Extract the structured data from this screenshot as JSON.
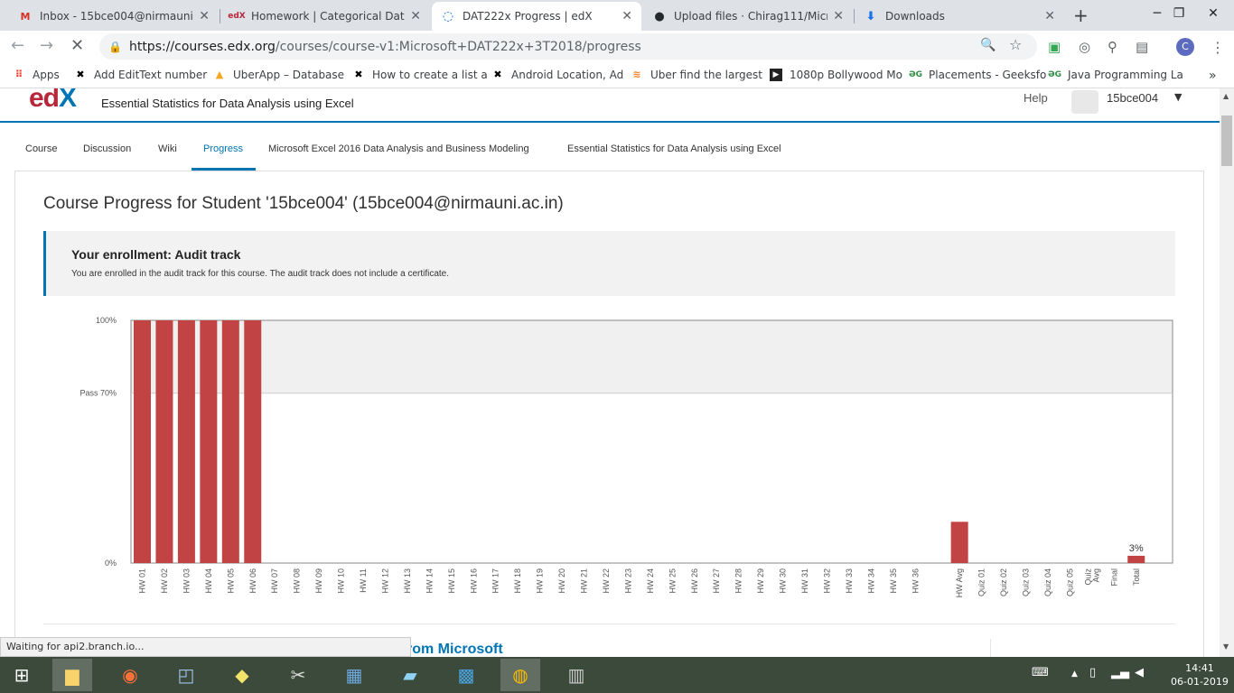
{
  "browser": {
    "tabs": [
      {
        "label": "Inbox - 15bce004@nirmauni.ac",
        "icon": "gmail-icon",
        "active": false
      },
      {
        "label": "Homework | Categorical Data, P",
        "icon": "edx-icon",
        "active": false
      },
      {
        "label": "DAT222x Progress | edX",
        "icon": "loading-icon",
        "active": true
      },
      {
        "label": "Upload files · Chirag111/Micros",
        "icon": "github-icon",
        "active": false
      },
      {
        "label": "Downloads",
        "icon": "download-icon",
        "active": false
      }
    ],
    "url_host": "https://courses.edx.org",
    "url_path": "/courses/course-v1:Microsoft+DAT222x+3T2018/progress",
    "profile_initial": "C",
    "bookmarks": [
      {
        "label": "Apps"
      },
      {
        "label": "Add EditText number"
      },
      {
        "label": "UberApp – Database"
      },
      {
        "label": "How to create a list a"
      },
      {
        "label": "Android Location, Ad"
      },
      {
        "label": "Uber find the largest"
      },
      {
        "label": "1080p Bollywood Mo"
      },
      {
        "label": "Placements - Geeksfo"
      },
      {
        "label": "Java Programming La"
      }
    ],
    "status_text": "Waiting for api2.branch.io..."
  },
  "site": {
    "logo_main": "ed",
    "logo_accent": "X",
    "course_name": "Essential Statistics for Data Analysis using Excel",
    "help": "Help",
    "username": "15bce004",
    "nav": [
      {
        "label": "Course"
      },
      {
        "label": "Discussion"
      },
      {
        "label": "Wiki"
      },
      {
        "label": "Progress"
      },
      {
        "label": "Microsoft Excel 2016 Data Analysis and Business Modeling"
      },
      {
        "label": "Essential Statistics for Data Analysis using Excel"
      }
    ]
  },
  "progress": {
    "title": "Course Progress for Student '15bce004' (15bce004@nirmauni.ac.in)",
    "enrollment_title": "Your enrollment: Audit track",
    "enrollment_text": "You are enrolled in the audit track for this course. The audit track does not include a certificate.",
    "partial_heading": "rom Microsoft"
  },
  "chart_data": {
    "type": "bar",
    "categories": [
      "HW 01",
      "HW 02",
      "HW 03",
      "HW 04",
      "HW 05",
      "HW 06",
      "HW 07",
      "HW 08",
      "HW 09",
      "HW 10",
      "HW 11",
      "HW 12",
      "HW 13",
      "HW 14",
      "HW 15",
      "HW 16",
      "HW 17",
      "HW 18",
      "HW 19",
      "HW 20",
      "HW 21",
      "HW 22",
      "HW 23",
      "HW 24",
      "HW 25",
      "HW 26",
      "HW 27",
      "HW 28",
      "HW 29",
      "HW 30",
      "HW 31",
      "HW 32",
      "HW 33",
      "HW 34",
      "HW 35",
      "HW 36",
      "",
      "HW Avg",
      "Quiz 01",
      "Quiz 02",
      "Quiz 03",
      "Quiz 04",
      "Quiz 05",
      "Quiz Avg",
      "Final",
      "Total"
    ],
    "values": [
      100,
      100,
      100,
      100,
      100,
      100,
      0,
      0,
      0,
      0,
      0,
      0,
      0,
      0,
      0,
      0,
      0,
      0,
      0,
      0,
      0,
      0,
      0,
      0,
      0,
      0,
      0,
      0,
      0,
      0,
      0,
      0,
      0,
      0,
      0,
      0,
      null,
      17,
      0,
      0,
      0,
      0,
      0,
      0,
      0,
      3
    ],
    "y_ticks": [
      "100%",
      "Pass 70%",
      "0%"
    ],
    "pass_value": 70,
    "ylim": [
      0,
      100
    ],
    "total_label": "3%",
    "bar_color": "#c14344",
    "pass_band_color": "#f0f0f0"
  },
  "taskbar": {
    "time": "14:41",
    "date": "06-01-2019"
  }
}
